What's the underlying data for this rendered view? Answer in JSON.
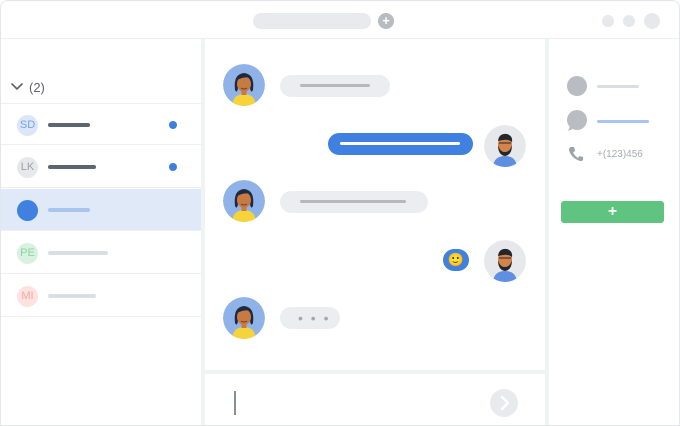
{
  "titlebar": {
    "new_tab_icon": "plus-icon",
    "window_controls": [
      "window-dot-1",
      "window-dot-2",
      "window-dot-3"
    ]
  },
  "sidebar": {
    "group_label": "(2)",
    "group_icon": "chevron-down-icon",
    "contacts": [
      {
        "initials": "SD",
        "avatar_bg": "#dbe7f8",
        "avatar_fg": "#7aa3e0",
        "line_color": "#5c6670",
        "unread": true
      },
      {
        "initials": "LK",
        "avatar_bg": "#e7e8ea",
        "avatar_fg": "#9ca1a7",
        "line_color": "#5c6670",
        "unread": true
      },
      {
        "initials": "",
        "avatar_bg": "#3f80e0",
        "avatar_fg": "#ffffff",
        "line_color": "#a8c5f0",
        "unread": false,
        "selected": true
      },
      {
        "initials": "PE",
        "avatar_bg": "#d8f1e0",
        "avatar_fg": "#8fd3a4",
        "line_color": "#dadde1",
        "unread": false
      },
      {
        "initials": "MI",
        "avatar_bg": "#fde2e0",
        "avatar_fg": "#f3aaa4",
        "line_color": "#dadde1",
        "unread": false
      }
    ],
    "unread_color": "#3d7fdb"
  },
  "chat": {
    "messages": [
      {
        "from": "her",
        "kind": "text"
      },
      {
        "from": "me",
        "kind": "text"
      },
      {
        "from": "her",
        "kind": "text"
      },
      {
        "from": "me",
        "kind": "emoji",
        "emoji": "🙂"
      },
      {
        "from": "her",
        "kind": "typing",
        "text": "• • •"
      }
    ],
    "incoming_bubble_color": "#ebedf0",
    "outgoing_bubble_color": "#3f80e0"
  },
  "composer": {
    "send_icon": "chevron-right-icon"
  },
  "details": {
    "phone": "+(123)456",
    "phone_icon": "phone-icon",
    "add_button_label": "+",
    "add_button_color": "#5ec47f"
  }
}
